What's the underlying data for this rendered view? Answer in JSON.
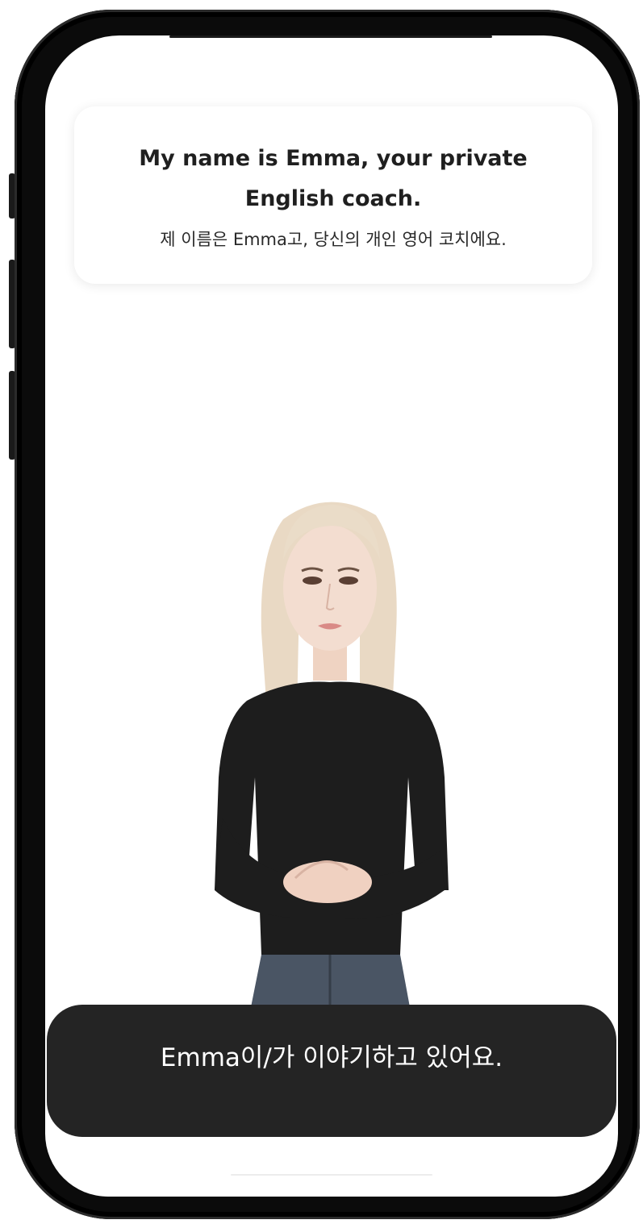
{
  "intro": {
    "title": "My name is Emma, your private English coach.",
    "subtitle": "제 이름은 Emma고, 당신의 개인 영어 코치에요."
  },
  "status": {
    "text": "Emma이/가 이야기하고 있어요."
  },
  "colors": {
    "banner_background": "#242424",
    "banner_text": "#ffffff",
    "card_background": "#ffffff",
    "title_text": "#1f1f1f",
    "phone_frame": "#0b0b0b"
  },
  "icons": {
    "avatar": "emma-avatar-image"
  }
}
